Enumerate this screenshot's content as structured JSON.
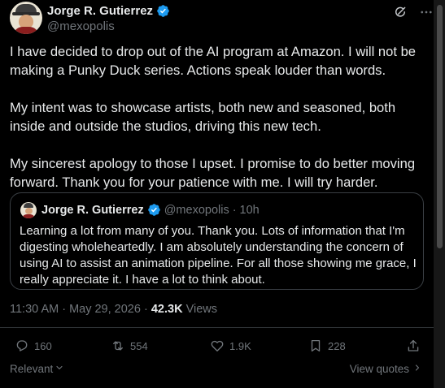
{
  "author": {
    "name": "Jorge R. Gutierrez",
    "handle": "@mexopolis"
  },
  "post": {
    "paragraphs": [
      "I have decided to drop out of the AI program at Amazon. I will not be making a Punky Duck series. Actions speak louder than words.",
      "My intent was to showcase artists, both new and seasoned, both inside and outside the studios, driving this new tech.",
      "My sincerest apology to those I upset. I promise to do better moving forward. Thank you for your patience with me. I will try harder."
    ],
    "timestamp": "11:30 AM · May 29, 2026",
    "separator": "·",
    "views_count": "42.3K",
    "views_label": "Views"
  },
  "quote": {
    "name": "Jorge R. Gutierrez",
    "handle": "@mexopolis",
    "separator": "·",
    "age": "10h",
    "text": "Learning a lot from many of you. Thank you. Lots of information that I'm digesting wholeheartedly.  I am absolutely understanding the concern of using AI to assist an animation pipeline.  For all those showing me grace, I really appreciate it. I have a lot to think about."
  },
  "actions": {
    "replies": "160",
    "reposts": "554",
    "likes": "1.9K",
    "bookmarks": "228"
  },
  "footer": {
    "sort_label": "Relevant",
    "view_quotes_label": "View quotes"
  },
  "icons": [
    "verified-badge-icon",
    "grok-icon",
    "more-icon",
    "reply-icon",
    "repost-icon",
    "like-icon",
    "bookmark-icon",
    "share-icon",
    "chevron-down-icon",
    "chevron-right-icon"
  ],
  "colors": {
    "background": "#000000",
    "text": "#e7e9ea",
    "secondary": "#71767b",
    "verified": "#1d9bf0",
    "border": "#2f3336"
  }
}
